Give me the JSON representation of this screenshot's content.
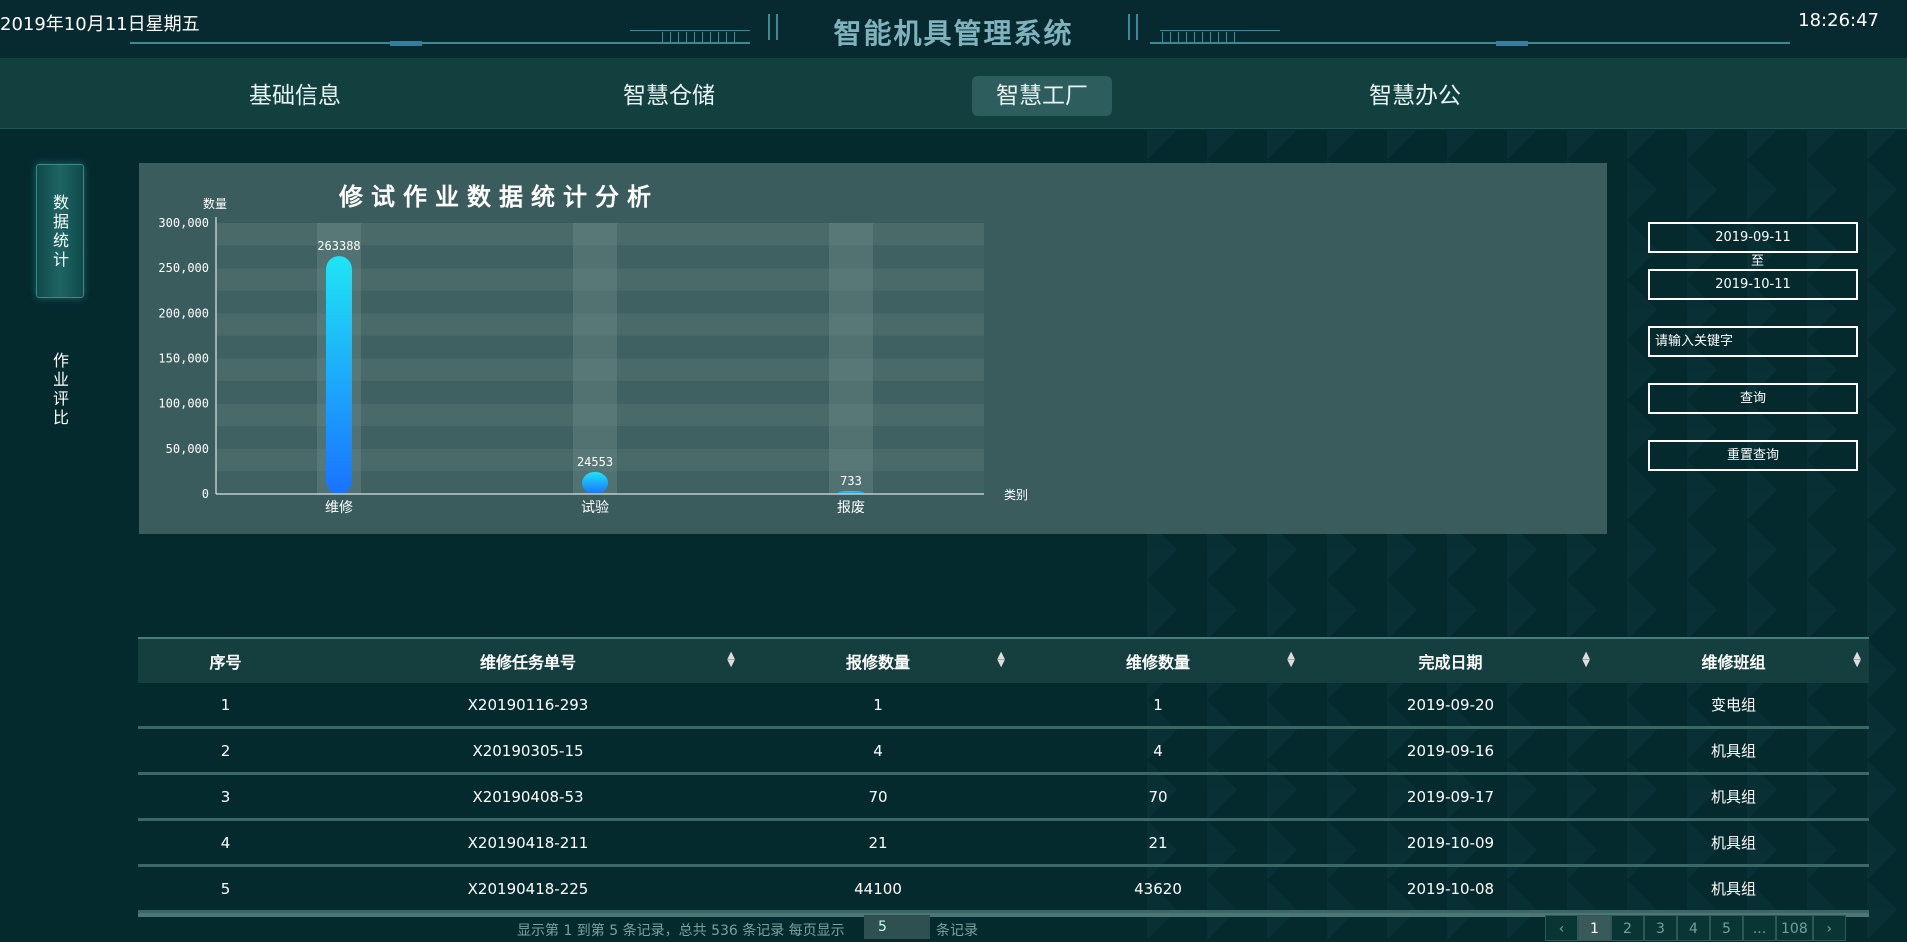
{
  "header": {
    "date": "2019年10月11日星期五",
    "time": "18:26:47",
    "title": "智能机具管理系统"
  },
  "nav": {
    "items": [
      "基础信息",
      "智慧仓储",
      "智慧工厂",
      "智慧办公"
    ],
    "active": "智慧工厂"
  },
  "sidebar": {
    "items": [
      "数据统计",
      "作业评比"
    ],
    "active": "数据统计"
  },
  "chart_data": {
    "type": "bar",
    "title": "修试作业数据统计分析",
    "ylabel": "数量",
    "xlabel": "类别",
    "categories": [
      "维修",
      "试验",
      "报废"
    ],
    "values": [
      263388,
      24553,
      733
    ],
    "value_labels": [
      "263388",
      "24553",
      "733"
    ],
    "ylim": [
      0,
      300000
    ],
    "yticks": [
      "0",
      "50,000",
      "100,000",
      "150,000",
      "200,000",
      "250,000",
      "300,000"
    ],
    "yticks_values": [
      0,
      50000,
      100000,
      150000,
      200000,
      250000,
      300000
    ],
    "grid": true,
    "colors": {
      "bar_top": "#1ee5f5",
      "bar_bottom": "#1a73ff"
    }
  },
  "filters": {
    "start_date": "2019-09-11",
    "to_label": "至",
    "end_date": "2019-10-11",
    "keyword_placeholder": "请输入关键字",
    "search_label": "查询",
    "reset_label": "重置查询"
  },
  "table": {
    "headers": [
      "序号",
      "维修任务单号",
      "报修数量",
      "维修数量",
      "完成日期",
      "维修班组"
    ],
    "rows": [
      [
        "1",
        "X20190116-293",
        "1",
        "1",
        "2019-09-20",
        "变电组"
      ],
      [
        "2",
        "X20190305-15",
        "4",
        "4",
        "2019-09-16",
        "机具组"
      ],
      [
        "3",
        "X20190408-53",
        "70",
        "70",
        "2019-09-17",
        "机具组"
      ],
      [
        "4",
        "X20190418-211",
        "21",
        "21",
        "2019-10-09",
        "机具组"
      ],
      [
        "5",
        "X20190418-225",
        "44100",
        "43620",
        "2019-10-08",
        "机具组"
      ]
    ]
  },
  "pagination": {
    "summary": "显示第 1 到第 5 条记录，总共 536 条记录 每页显示",
    "page_size": "5",
    "suffix": "条记录",
    "pages": [
      "‹",
      "1",
      "2",
      "3",
      "4",
      "5",
      "...",
      "108",
      "›"
    ],
    "active_page": "1"
  }
}
